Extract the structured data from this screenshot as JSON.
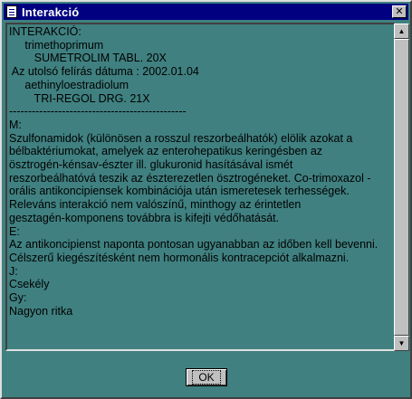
{
  "window": {
    "title": "Interakció",
    "close_label": "✕"
  },
  "content": {
    "lines": [
      "INTERAKCIÓ:",
      "     trimethoprimum",
      "        SUMETROLIM TABL. 20X",
      " Az utolsó felírás dátuma : 2002.01.04",
      "     aethinyloestradiolum",
      "        TRI-REGOL DRG. 21X",
      "-----------------------------------------------",
      "M:",
      "Szulfonamidok (különösen a rosszul reszorbeálhatók) elölik azokat a",
      "bélbaktériumokat, amelyek az enterohepatikus keringésben az",
      "ösztrogén-kénsav-észter ill. glukuronid hasításával ismét",
      "reszorbeálhatóvá teszik az észterezetlen ösztrogéneket. Co-trimoxazol -",
      "orális antikoncipiensek kombinációja után ismeretesek terhességek.",
      "Releváns interakció nem valószínű, minthogy az érintetlen",
      "gesztagén-komponens továbbra is kifejti védőhatását.",
      "E:",
      "Az antikoncipienst naponta pontosan ugyanabban az időben kell bevenni.",
      "Célszerű kiegészítésként nem hormonális kontracepciót alkalmazni.",
      "J:",
      "Csekély",
      "Gy:",
      "Nagyon ritka"
    ]
  },
  "scrollbar": {
    "up_icon": "▲",
    "down_icon": "▼"
  },
  "ok_button": {
    "label": "OK"
  },
  "colors": {
    "window_bg": "#408080",
    "titlebar_bg": "#000080",
    "face": "#c0c0c0"
  }
}
